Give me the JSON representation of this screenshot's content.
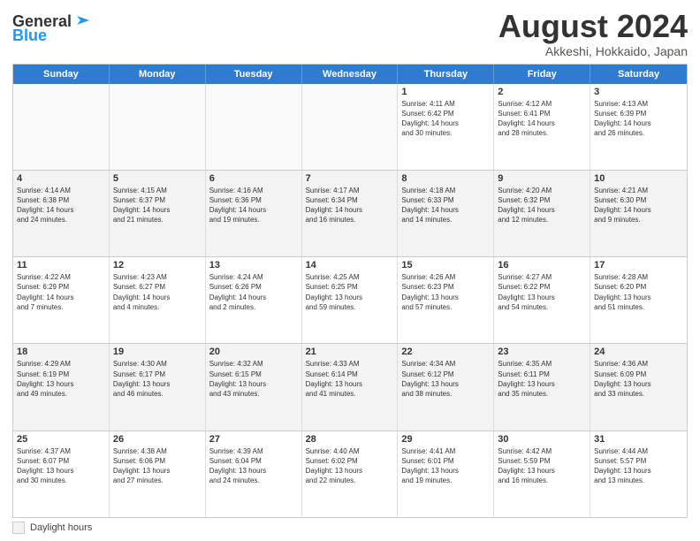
{
  "header": {
    "logo_line1": "General",
    "logo_line2": "Blue",
    "title": "August 2024",
    "subtitle": "Akkeshi, Hokkaido, Japan"
  },
  "calendar": {
    "days_of_week": [
      "Sunday",
      "Monday",
      "Tuesday",
      "Wednesday",
      "Thursday",
      "Friday",
      "Saturday"
    ],
    "weeks": [
      [
        {
          "day": "",
          "info": ""
        },
        {
          "day": "",
          "info": ""
        },
        {
          "day": "",
          "info": ""
        },
        {
          "day": "",
          "info": ""
        },
        {
          "day": "1",
          "info": "Sunrise: 4:11 AM\nSunset: 6:42 PM\nDaylight: 14 hours\nand 30 minutes."
        },
        {
          "day": "2",
          "info": "Sunrise: 4:12 AM\nSunset: 6:41 PM\nDaylight: 14 hours\nand 28 minutes."
        },
        {
          "day": "3",
          "info": "Sunrise: 4:13 AM\nSunset: 6:39 PM\nDaylight: 14 hours\nand 26 minutes."
        }
      ],
      [
        {
          "day": "4",
          "info": "Sunrise: 4:14 AM\nSunset: 6:38 PM\nDaylight: 14 hours\nand 24 minutes."
        },
        {
          "day": "5",
          "info": "Sunrise: 4:15 AM\nSunset: 6:37 PM\nDaylight: 14 hours\nand 21 minutes."
        },
        {
          "day": "6",
          "info": "Sunrise: 4:16 AM\nSunset: 6:36 PM\nDaylight: 14 hours\nand 19 minutes."
        },
        {
          "day": "7",
          "info": "Sunrise: 4:17 AM\nSunset: 6:34 PM\nDaylight: 14 hours\nand 16 minutes."
        },
        {
          "day": "8",
          "info": "Sunrise: 4:18 AM\nSunset: 6:33 PM\nDaylight: 14 hours\nand 14 minutes."
        },
        {
          "day": "9",
          "info": "Sunrise: 4:20 AM\nSunset: 6:32 PM\nDaylight: 14 hours\nand 12 minutes."
        },
        {
          "day": "10",
          "info": "Sunrise: 4:21 AM\nSunset: 6:30 PM\nDaylight: 14 hours\nand 9 minutes."
        }
      ],
      [
        {
          "day": "11",
          "info": "Sunrise: 4:22 AM\nSunset: 6:29 PM\nDaylight: 14 hours\nand 7 minutes."
        },
        {
          "day": "12",
          "info": "Sunrise: 4:23 AM\nSunset: 6:27 PM\nDaylight: 14 hours\nand 4 minutes."
        },
        {
          "day": "13",
          "info": "Sunrise: 4:24 AM\nSunset: 6:26 PM\nDaylight: 14 hours\nand 2 minutes."
        },
        {
          "day": "14",
          "info": "Sunrise: 4:25 AM\nSunset: 6:25 PM\nDaylight: 13 hours\nand 59 minutes."
        },
        {
          "day": "15",
          "info": "Sunrise: 4:26 AM\nSunset: 6:23 PM\nDaylight: 13 hours\nand 57 minutes."
        },
        {
          "day": "16",
          "info": "Sunrise: 4:27 AM\nSunset: 6:22 PM\nDaylight: 13 hours\nand 54 minutes."
        },
        {
          "day": "17",
          "info": "Sunrise: 4:28 AM\nSunset: 6:20 PM\nDaylight: 13 hours\nand 51 minutes."
        }
      ],
      [
        {
          "day": "18",
          "info": "Sunrise: 4:29 AM\nSunset: 6:19 PM\nDaylight: 13 hours\nand 49 minutes."
        },
        {
          "day": "19",
          "info": "Sunrise: 4:30 AM\nSunset: 6:17 PM\nDaylight: 13 hours\nand 46 minutes."
        },
        {
          "day": "20",
          "info": "Sunrise: 4:32 AM\nSunset: 6:15 PM\nDaylight: 13 hours\nand 43 minutes."
        },
        {
          "day": "21",
          "info": "Sunrise: 4:33 AM\nSunset: 6:14 PM\nDaylight: 13 hours\nand 41 minutes."
        },
        {
          "day": "22",
          "info": "Sunrise: 4:34 AM\nSunset: 6:12 PM\nDaylight: 13 hours\nand 38 minutes."
        },
        {
          "day": "23",
          "info": "Sunrise: 4:35 AM\nSunset: 6:11 PM\nDaylight: 13 hours\nand 35 minutes."
        },
        {
          "day": "24",
          "info": "Sunrise: 4:36 AM\nSunset: 6:09 PM\nDaylight: 13 hours\nand 33 minutes."
        }
      ],
      [
        {
          "day": "25",
          "info": "Sunrise: 4:37 AM\nSunset: 6:07 PM\nDaylight: 13 hours\nand 30 minutes."
        },
        {
          "day": "26",
          "info": "Sunrise: 4:38 AM\nSunset: 6:06 PM\nDaylight: 13 hours\nand 27 minutes."
        },
        {
          "day": "27",
          "info": "Sunrise: 4:39 AM\nSunset: 6:04 PM\nDaylight: 13 hours\nand 24 minutes."
        },
        {
          "day": "28",
          "info": "Sunrise: 4:40 AM\nSunset: 6:02 PM\nDaylight: 13 hours\nand 22 minutes."
        },
        {
          "day": "29",
          "info": "Sunrise: 4:41 AM\nSunset: 6:01 PM\nDaylight: 13 hours\nand 19 minutes."
        },
        {
          "day": "30",
          "info": "Sunrise: 4:42 AM\nSunset: 5:59 PM\nDaylight: 13 hours\nand 16 minutes."
        },
        {
          "day": "31",
          "info": "Sunrise: 4:44 AM\nSunset: 5:57 PM\nDaylight: 13 hours\nand 13 minutes."
        }
      ]
    ]
  },
  "footer": {
    "label": "Daylight hours"
  }
}
